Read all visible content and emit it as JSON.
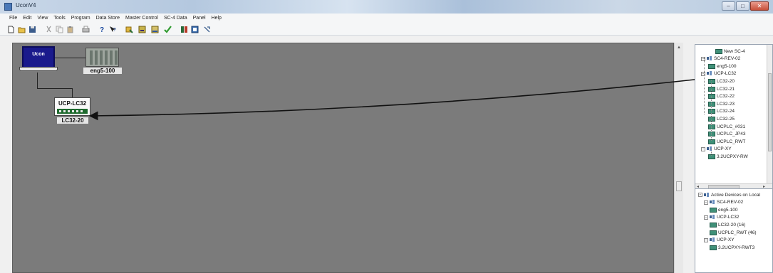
{
  "window": {
    "title": "UconV4"
  },
  "menu": [
    "File",
    "Edit",
    "View",
    "Tools",
    "Program",
    "Data Store",
    "Master Control",
    "SC-4 Data",
    "Panel",
    "Help"
  ],
  "toolbar_icons": [
    "new-file-icon",
    "open-folder-icon",
    "save-icon",
    "cut-icon",
    "copy-icon",
    "paste-icon",
    "print-icon",
    "help-icon",
    "context-help-icon",
    "connect-icon",
    "device-icon",
    "data-icon",
    "check-icon",
    "grid-icon",
    "refresh-icon",
    "pin-icon"
  ],
  "canvas": {
    "host": {
      "label": "Ucon"
    },
    "sc4_device": {
      "label": "eng5-100"
    },
    "ucp_device": {
      "name": "UCP-LC32",
      "label": "LC32-20"
    }
  },
  "device_tree": {
    "items": [
      {
        "label": "New SC-4",
        "level": 2,
        "kind": "device"
      },
      {
        "label": "SC4-REV-02",
        "level": 0,
        "kind": "group"
      },
      {
        "label": "eng5-100",
        "level": 1,
        "kind": "device"
      },
      {
        "label": "UCP-LC32",
        "level": 0,
        "kind": "group"
      },
      {
        "label": "LC32-20",
        "level": 1,
        "kind": "device"
      },
      {
        "label": "LC32-21",
        "level": 1,
        "kind": "device"
      },
      {
        "label": "LC32-22",
        "level": 1,
        "kind": "device"
      },
      {
        "label": "LC32-23",
        "level": 1,
        "kind": "device"
      },
      {
        "label": "LC32-24",
        "level": 1,
        "kind": "device"
      },
      {
        "label": "LC32-25",
        "level": 1,
        "kind": "device"
      },
      {
        "label": "UCPLC_#031",
        "level": 1,
        "kind": "device"
      },
      {
        "label": "UCPLC_JP43",
        "level": 1,
        "kind": "device"
      },
      {
        "label": "UCPLC_RWT",
        "level": 1,
        "kind": "device"
      },
      {
        "label": "UCP-XY",
        "level": 0,
        "kind": "group"
      },
      {
        "label": "3.2UCPXY-RW",
        "level": 1,
        "kind": "device"
      }
    ]
  },
  "active_devices": {
    "items": [
      {
        "label": "Active Devices on Local",
        "level": 0,
        "kind": "root"
      },
      {
        "label": "SC4-REV-02",
        "level": 1,
        "kind": "group"
      },
      {
        "label": "eng5-100",
        "level": 2,
        "kind": "device"
      },
      {
        "label": "UCP-LC32",
        "level": 1,
        "kind": "group"
      },
      {
        "label": "LC32-20 (16)",
        "level": 2,
        "kind": "device"
      },
      {
        "label": "UCPLC_RWT (46)",
        "level": 2,
        "kind": "device"
      },
      {
        "label": "UCP-XY",
        "level": 1,
        "kind": "group"
      },
      {
        "label": "3.2UCPXY-RWT3",
        "level": 2,
        "kind": "device"
      }
    ]
  }
}
